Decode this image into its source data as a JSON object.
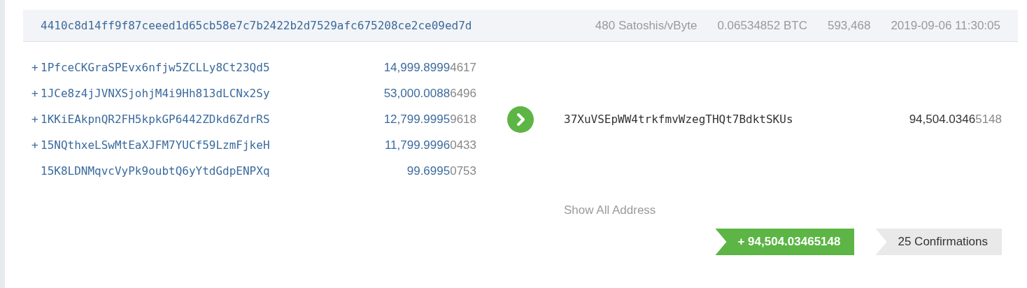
{
  "transaction": {
    "hash": "4410c8d14ff9f87ceeed1d65cb58e7c7b2422b2d7529afc675208ce2ce09ed7d",
    "fee_rate": "480 Satoshis/vByte",
    "fee": "0.06534852 BTC",
    "block": "593,468",
    "time": "2019-09-06 11:30:05"
  },
  "inputs": [
    {
      "prefix": "+",
      "address": "1PfceCKGraSPEvx6nfjw5ZCLLy8Ct23Qd5",
      "amount": "14,999.89994617"
    },
    {
      "prefix": "+",
      "address": "1JCe8z4jJVNXSjohjM4i9Hh813dLCNx2Sy",
      "amount": "53,000.00886496"
    },
    {
      "prefix": "+",
      "address": "1KKiEAkpnQR2FH5kpkGP6442ZDkd6ZdrRS",
      "amount": "12,799.99959618"
    },
    {
      "prefix": "+",
      "address": "15NQthxeLSwMtEaXJFM7YUCf59LzmFjkeH",
      "amount": "11,799.99960433"
    },
    {
      "address": "15K8LDNMqvcVyPk9oubtQ6yYtdGdpENPXq",
      "amount": "99.69950753"
    }
  ],
  "outputs": [
    {
      "address": "37XuVSEpWW4trkfmvWzegTHQt7BdktSKUs",
      "amount": "94,504.03465148"
    }
  ],
  "show_all": "Show All Address",
  "total": "+ 94,504.03465148",
  "confirmations": "25 Confirmations"
}
